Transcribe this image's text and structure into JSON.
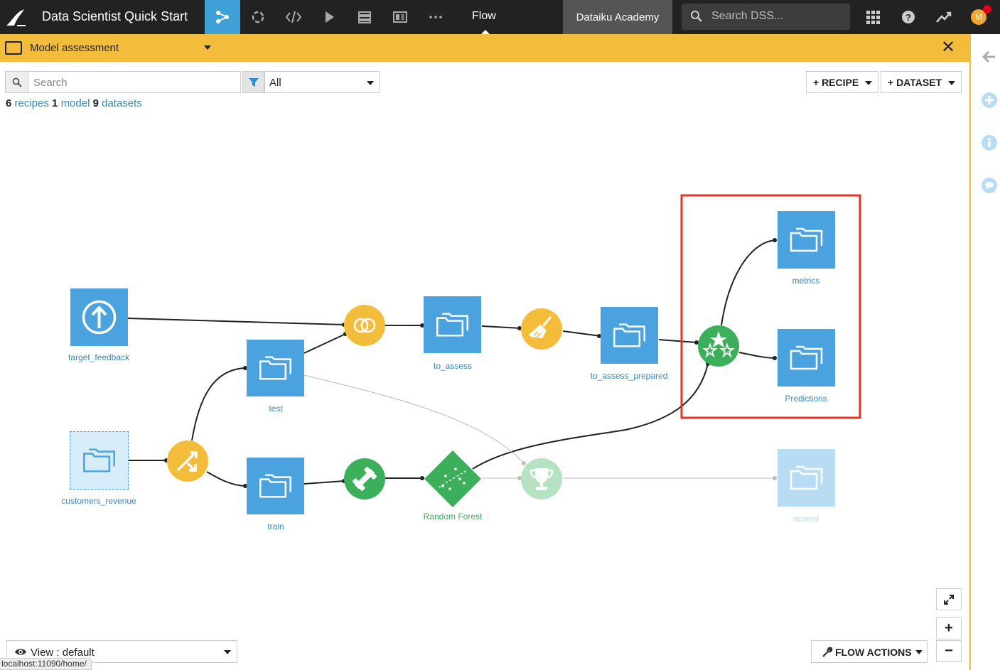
{
  "header": {
    "project_title": "Data Scientist Quick Start",
    "nav_items": [
      {
        "name": "flow-icon",
        "active": true
      },
      {
        "name": "lab-icon",
        "active": false
      },
      {
        "name": "code-icon",
        "active": false
      },
      {
        "name": "run-icon",
        "active": false
      },
      {
        "name": "database-icon",
        "active": false
      },
      {
        "name": "dashboard-icon",
        "active": false
      },
      {
        "name": "more-icon",
        "active": false
      }
    ],
    "current_section": "Flow",
    "instance_name": "Dataiku Academy",
    "search_placeholder": "Search DSS...",
    "avatar_initial": "M"
  },
  "zone": {
    "name": "Model assessment",
    "close_symbol": "✕",
    "accent_color": "#f3bd3b"
  },
  "toolbar": {
    "search_placeholder": "Search",
    "filter_value": "All",
    "recipe_button": "+ RECIPE",
    "dataset_button": "+ DATASET"
  },
  "counts": {
    "recipes_count": "6",
    "recipes_label": "recipes",
    "models_count": "1",
    "models_label": "model",
    "datasets_count": "9",
    "datasets_label": "datasets"
  },
  "flow": {
    "datasets": [
      {
        "id": "target_feedback",
        "label": "target_feedback",
        "icon": "upload-icon"
      },
      {
        "id": "customers_revenue",
        "label": "customers_revenue",
        "icon": "folder-icon"
      },
      {
        "id": "test",
        "label": "test",
        "icon": "folder-icon"
      },
      {
        "id": "train",
        "label": "train",
        "icon": "folder-icon"
      },
      {
        "id": "to_assess",
        "label": "to_assess",
        "icon": "folder-icon"
      },
      {
        "id": "to_assess_prepared",
        "label": "to_assess_prepared",
        "icon": "folder-icon"
      },
      {
        "id": "metrics",
        "label": "metrics",
        "icon": "folder-icon"
      },
      {
        "id": "predictions",
        "label": "Predictions",
        "icon": "folder-icon"
      },
      {
        "id": "scored",
        "label": "scored",
        "icon": "folder-icon"
      }
    ],
    "model": {
      "id": "random_forest",
      "label": "Random Forest",
      "icon": "model-icon"
    },
    "recipes": [
      {
        "id": "join",
        "icon": "join-icon"
      },
      {
        "id": "split",
        "icon": "split-icon"
      },
      {
        "id": "prepare",
        "icon": "broom-icon"
      },
      {
        "id": "train",
        "icon": "dumbbell-icon"
      },
      {
        "id": "evaluate",
        "icon": "evaluate-stars-icon"
      },
      {
        "id": "score",
        "icon": "trophy-icon"
      }
    ],
    "colors": {
      "dataset": "#4aa3df",
      "recipe_visual": "#f3bd3b",
      "recipe_ml": "#3caf5a",
      "highlight": "#e63222"
    }
  },
  "bottom": {
    "view_label": "View : default",
    "status_url": "localhost:11090/home/",
    "flow_actions": "FLOW ACTIONS",
    "zoom_in": "+",
    "zoom_out": "−"
  }
}
